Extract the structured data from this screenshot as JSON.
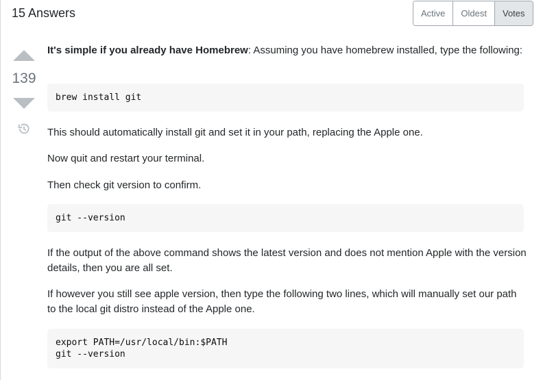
{
  "answers_header": {
    "count_label": "15 Answers"
  },
  "sort_tabs": [
    {
      "label": "Active",
      "selected": false
    },
    {
      "label": "Oldest",
      "selected": false
    },
    {
      "label": "Votes",
      "selected": true
    }
  ],
  "vote": {
    "score": "139"
  },
  "post": {
    "p1_strong": "It's simple if you already have Homebrew",
    "p1_rest": ": Assuming you have homebrew installed, type the following:",
    "code1": "brew install git",
    "p2": "This should automatically install git and set it in your path, replacing the Apple one.",
    "p3": "Now quit and restart your terminal.",
    "p4": "Then check git version to confirm.",
    "code2": "git --version",
    "p5": "If the output of the above command shows the latest version and does not mention Apple with the version details, then you are all set.",
    "p6": "If however you still see apple version, then type the following two lines, which will manually set our path to the local git distro instead of the Apple one.",
    "code3": "export PATH=/usr/local/bin:$PATH\ngit --version"
  },
  "icons": {
    "vote_up": "triangle-up-icon",
    "vote_down": "triangle-down-icon",
    "history": "history-icon"
  },
  "colors": {
    "vote_arrow": "#babfc4",
    "code_bg": "#f6f6f6",
    "selected_tab_bg": "#e3e6e8"
  }
}
